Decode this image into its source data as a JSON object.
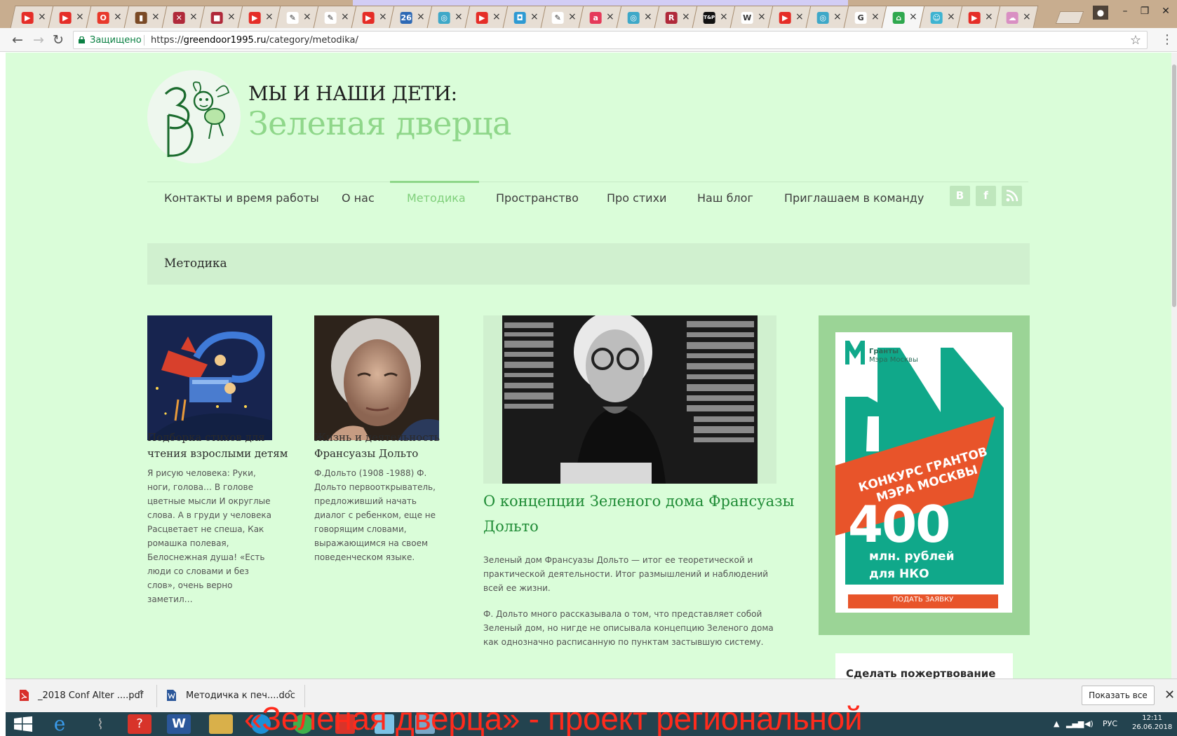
{
  "browser": {
    "tabs": [
      {
        "icon": "youtube-icon",
        "color": "#e52d27",
        "glyph": "▶"
      },
      {
        "icon": "youtube-icon",
        "color": "#e52d27",
        "glyph": "▶"
      },
      {
        "icon": "opera-icon",
        "color": "#e8392b",
        "glyph": "O"
      },
      {
        "icon": "music-icon",
        "color": "#7a4a26",
        "glyph": "▮"
      },
      {
        "icon": "uk-flag-icon",
        "color": "#b0293a",
        "glyph": "✕"
      },
      {
        "icon": "book-icon",
        "color": "#b0293a",
        "glyph": "■"
      },
      {
        "icon": "youtube-icon",
        "color": "#e52d27",
        "glyph": "▶"
      },
      {
        "icon": "pen-icon",
        "color": "#ffffff",
        "glyph": "✎"
      },
      {
        "icon": "pen-icon",
        "color": "#ffffff",
        "glyph": "✎"
      },
      {
        "icon": "youtube-icon",
        "color": "#e52d27",
        "glyph": "▶"
      },
      {
        "icon": "calendar-icon",
        "color": "#2d69b5",
        "glyph": "26"
      },
      {
        "icon": "globe-icon",
        "color": "#3ea8c8",
        "glyph": "◎"
      },
      {
        "icon": "youtube-icon",
        "color": "#e52d27",
        "glyph": "▶"
      },
      {
        "icon": "photo-icon",
        "color": "#2e9ad3",
        "glyph": "◘"
      },
      {
        "icon": "pen-icon",
        "color": "#ffffff",
        "glyph": "✎"
      },
      {
        "icon": "a-letter-icon",
        "color": "#e53a5a",
        "glyph": "a"
      },
      {
        "icon": "globe-icon",
        "color": "#3ea8c8",
        "glyph": "◎"
      },
      {
        "icon": "r-letter-icon",
        "color": "#b0293a",
        "glyph": "R"
      },
      {
        "icon": "tp-icon",
        "color": "#111111",
        "glyph": "T&P"
      },
      {
        "icon": "wikipedia-icon",
        "color": "#ffffff",
        "glyph": "W"
      },
      {
        "icon": "youtube-icon",
        "color": "#e52d27",
        "glyph": "▶"
      },
      {
        "icon": "globe-icon",
        "color": "#3ea8c8",
        "glyph": "◎"
      },
      {
        "icon": "google-icon",
        "color": "#ffffff",
        "glyph": "G"
      },
      {
        "icon": "home-icon",
        "color": "#2fa84f",
        "glyph": "⌂"
      },
      {
        "icon": "smile-icon",
        "color": "#3db3d1",
        "glyph": "☺"
      },
      {
        "icon": "youtube-icon",
        "color": "#e52d27",
        "glyph": "▶"
      },
      {
        "icon": "cloud-icon",
        "color": "#d98fc3",
        "glyph": "☁"
      }
    ],
    "secure_label": "Защищено",
    "url_prefix": "https://",
    "url_host": "greendoor1995.ru",
    "url_path": "/category/metodika/"
  },
  "site": {
    "subtitle": "МЫ И НАШИ ДЕТИ:",
    "title": "Зеленая дверца",
    "nav": [
      "Контакты и время работы",
      "О нас",
      "Методика",
      "Пространство",
      "Про стихи",
      "Наш блог",
      "Приглашаем в команду"
    ],
    "social": [
      "В",
      "f",
      "rss"
    ],
    "breadcrumb": "Методика"
  },
  "posts": [
    {
      "title_line1": "Подборка стихов для",
      "title_line2": "чтения взрослыми детям",
      "excerpt": [
        "Я рисую человека: Руки,",
        "ноги, голова… В голове",
        "цветные мысли И округлые",
        "слова. А в груди у человека",
        "Расцветает не спеша, Как",
        "ромашка полевая,",
        "Белоснежная душа! «Есть",
        "люди со словами и  без",
        "слов», очень верно",
        "заметил…"
      ]
    },
    {
      "title_line1": "Жизнь и деятельность",
      "title_line2": "Франсуазы Дольто",
      "excerpt": [
        "Ф.Дольто (1908 -1988) Ф.",
        "Дольто первооткрыватель,",
        "предложивший начать",
        "диалог с ребенком, еще не",
        "говорящим словами,",
        "выражающимся на своем",
        "поведенческом языке."
      ]
    },
    {
      "title_line1": "О концепции Зеленого дома Франсуазы",
      "title_line2": "Дольто",
      "excerpt": [
        "Зеленый дом Франсуазы Дольто — итог ее теоретической и",
        "практической деятельности. Итог размышлений и наблюдений",
        "всей ее жизни.",
        "",
        "Ф. Дольто много рассказывала о том, что представляет собой",
        "Зеленый дом, но нигде не описывала концепцию Зеленого дома",
        "как однозначно расписанную по пунктам застывшую систему."
      ]
    }
  ],
  "ad": {
    "brand_line1": "Гранты",
    "brand_line2": "Мэра Москвы",
    "banner_line1": "КОНКУРС ГРАНТОВ",
    "banner_line2": "МЭРА МОСКВЫ",
    "amount": "400",
    "amount_line1": "млн. рублей",
    "amount_line2": "для НКО",
    "cta": "ПОДАТЬ ЗАЯВКУ"
  },
  "donate_label": "Сделать пожертвование",
  "downloads": {
    "items": [
      "_2018 Conf Alter ....pdf",
      "Методичка к печ....doc"
    ],
    "show_all": "Показать все"
  },
  "taskbar": {
    "lang": "РУС",
    "time": "12:11",
    "date": "26.06.2018"
  },
  "overlay_caption": "«Зеленая дверца» - проект региональной",
  "colors": {
    "page_bg": "#dafdd9",
    "accent_green": "#8fd78a",
    "link_green": "#1e8b35",
    "ad_teal": "#10a88a",
    "ad_orange": "#e8542a"
  }
}
